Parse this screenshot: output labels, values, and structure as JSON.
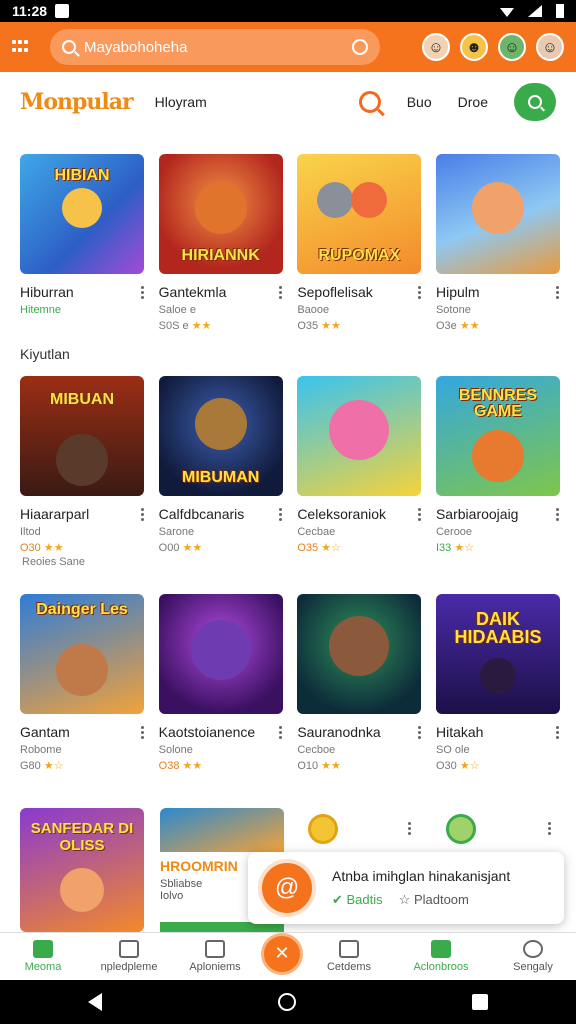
{
  "status": {
    "time": "11:28"
  },
  "appbar": {
    "search_placeholder": "Mayabohoheha",
    "avatars": [
      {
        "icon": "boy-avatar-icon"
      },
      {
        "icon": "cat-avatar-icon"
      },
      {
        "icon": "girl-avatar-icon"
      },
      {
        "icon": "woman-avatar-icon"
      }
    ]
  },
  "subheader": {
    "logo": "Monpular",
    "nav_label": "Hloyram",
    "link1": "Buo",
    "link2": "Droe"
  },
  "row1": [
    {
      "title_art": "HIBIAN",
      "name": "Hiburran",
      "meta": "Hitemne",
      "rating": "",
      "stars": ""
    },
    {
      "title_art": "HIRIANNK",
      "name": "Gantekmla",
      "meta": "Saloe e",
      "rating": "S0S e",
      "stars": "★★"
    },
    {
      "title_art": "RUPOMAX",
      "name": "Sepoflelisak",
      "meta": "Baooe",
      "rating": "O35",
      "stars": "★★"
    },
    {
      "title_art": "",
      "name": "Hipulm",
      "meta": "Sotone",
      "rating": "O3e",
      "stars": "★★"
    }
  ],
  "section_label": "Kiyutlan",
  "row2": [
    {
      "title_art": "MIBUAN",
      "name": "Hiaararparl",
      "meta": "Iltod",
      "rating": "O30",
      "stars": "★★"
    },
    {
      "title_art": "MIBUMAN",
      "name": "Calfdbcanaris",
      "meta": "Sarone",
      "rating": "O00",
      "stars": "★★"
    },
    {
      "title_art": "",
      "name": "Celeksoraniok",
      "meta": "Cecbae",
      "rating": "O35",
      "stars": "★☆"
    },
    {
      "title_art": "BENNRES GAME",
      "name": "Sarbiaroojaig",
      "meta": "Cerooe",
      "rating": "I33",
      "stars": "★☆"
    }
  ],
  "footnote": "Reoies Sane",
  "row3": [
    {
      "title_art": "Dainger Les",
      "name": "Gantam",
      "meta": "Robome",
      "rating": "G80",
      "stars": "★☆"
    },
    {
      "title_art": "",
      "name": "Kaotstoianence",
      "meta": "Solone",
      "rating": "O38",
      "stars": "★★"
    },
    {
      "title_art": "",
      "name": "Sauranodnka",
      "meta": "Cecboe",
      "rating": "O10",
      "stars": "★★"
    },
    {
      "title_art": "DAIK HIDAABIS",
      "name": "Hitakah",
      "meta": "SO ole",
      "rating": "O30",
      "stars": "★☆"
    }
  ],
  "row4": [
    {
      "title_art": "SANFEDAR DI OLISS"
    },
    {
      "title_art": "HROOMRIN",
      "sub1": "Sbliabse",
      "sub2": "Iolvo"
    }
  ],
  "popup": {
    "text": "Atnba imihglan hinakanisjant",
    "action1": "Badtis",
    "action2": "Pladtoom"
  },
  "bottomnav": {
    "items": [
      "Meoma",
      "npledpleme",
      "Aploniems",
      "",
      "Cetdems",
      "Aclonbroos",
      "Sengaly"
    ]
  },
  "colors": {
    "accent": "#f6731e",
    "green": "#3aab4a",
    "star": "#f0a81c"
  }
}
